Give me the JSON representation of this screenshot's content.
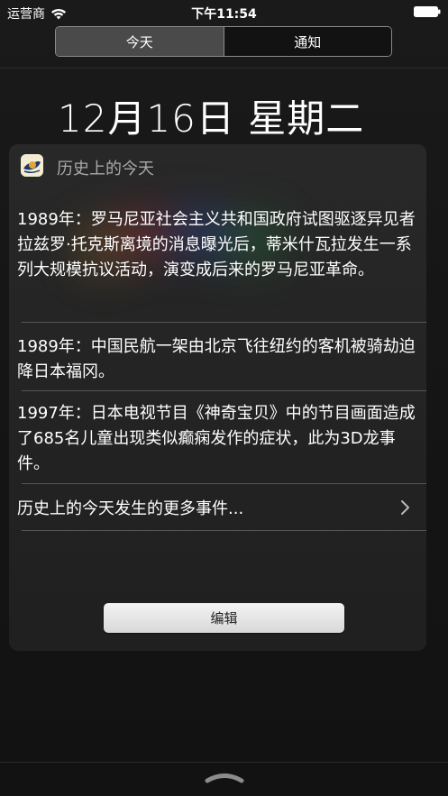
{
  "status_bar": {
    "carrier": "运营商",
    "time": "下午11:54",
    "wifi_icon": "wifi-icon",
    "battery_icon": "battery-icon"
  },
  "tabs": [
    {
      "label": "今天",
      "selected": true
    },
    {
      "label": "通知",
      "selected": false
    }
  ],
  "date_title": "12月16日 星期二",
  "widget": {
    "title": "历史上的今天",
    "app_icon": "history-app-icon",
    "events": [
      {
        "text": "1989年：罗马尼亚社会主义共和国政府试图驱逐异见者拉兹罗·托克斯离境的消息曝光后，蒂米什瓦拉发生一系列大规模抗议活动，演变成后来的罗马尼亚革命。"
      },
      {
        "text": "1989年：中国民航一架由北京飞往纽约的客机被骑劫迫降日本福冈。"
      },
      {
        "text": "1997年：日本电视节目《神奇宝贝》中的节目画面造成了685名儿童出现类似癫痫发作的症状，此为3D龙事件。"
      }
    ],
    "more_link": "历史上的今天发生的更多事件...",
    "edit_label": "编辑"
  },
  "colors": {
    "background": "#141414",
    "segment_active": "#4a4a4a",
    "secondary_text": "#a9a9a9"
  }
}
